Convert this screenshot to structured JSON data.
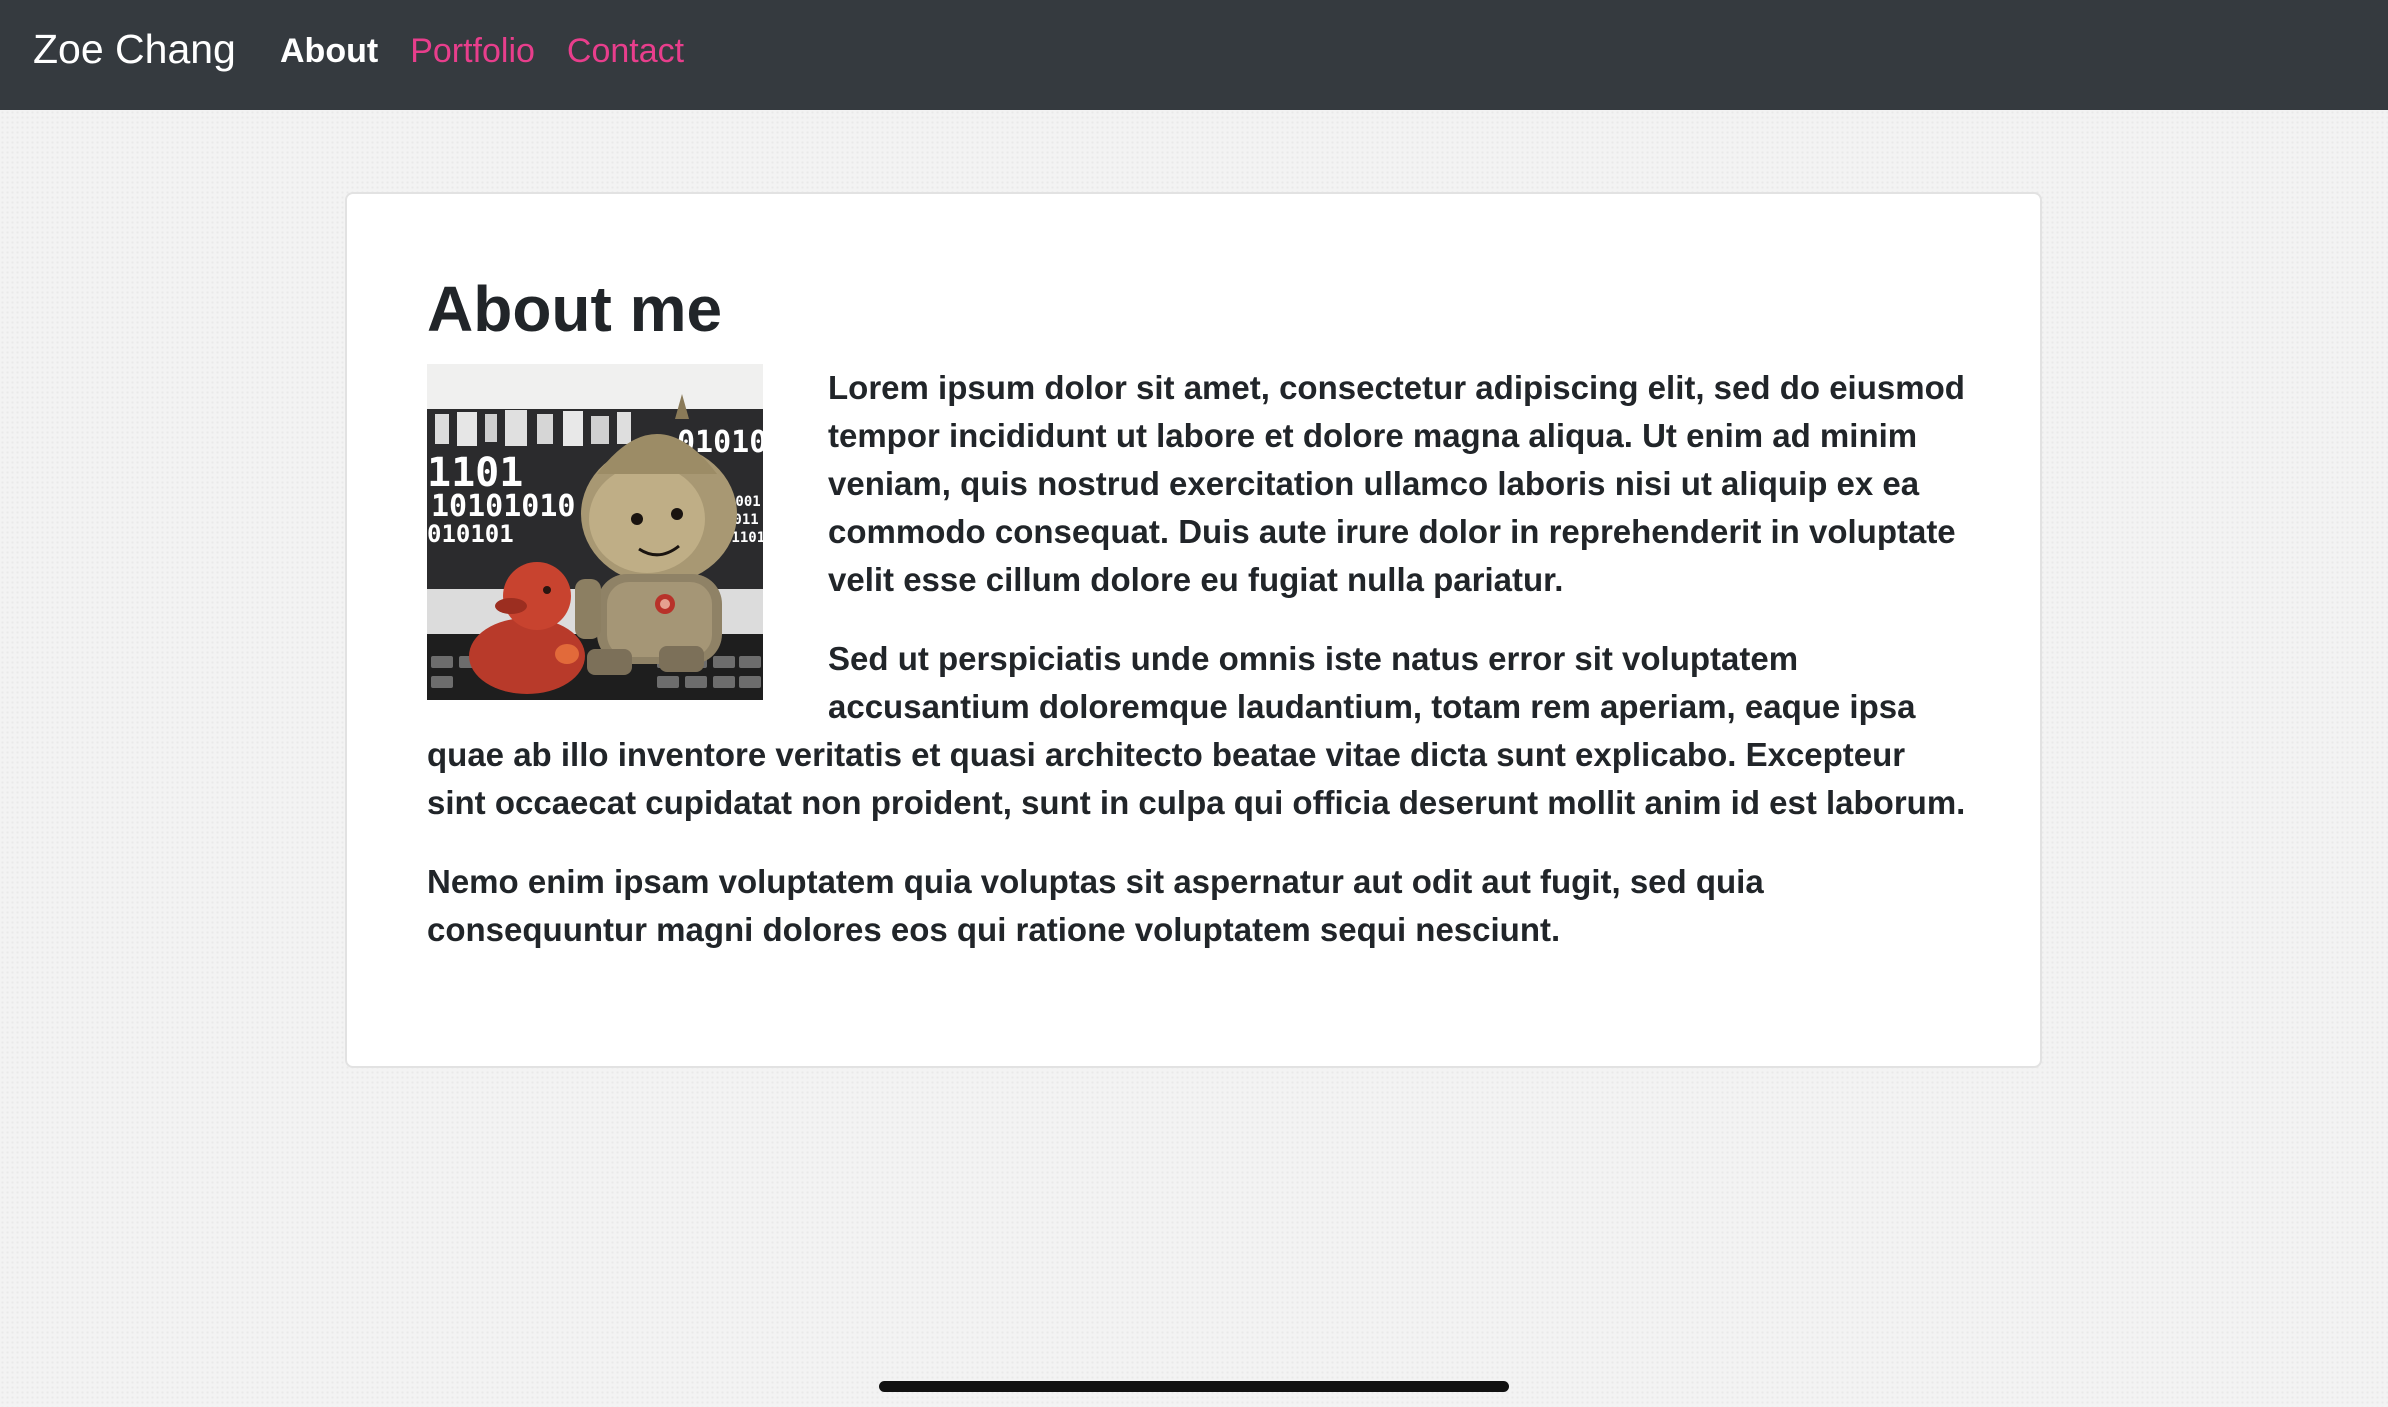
{
  "navbar": {
    "brand": "Zoe Chang",
    "links": [
      {
        "label": "About",
        "active": true
      },
      {
        "label": "Portfolio",
        "active": false
      },
      {
        "label": "Contact",
        "active": false
      }
    ],
    "background": "#353a3f",
    "accent": "#e83e8c"
  },
  "main": {
    "title": "About me",
    "paragraphs": [
      "Lorem ipsum dolor sit amet, consectetur adipiscing elit, sed do eiusmod tempor incididunt ut labore et dolore magna aliqua. Ut enim ad minim veniam, quis nostrud exercitation ullamco laboris nisi ut aliquip ex ea commodo consequat. Duis aute irure dolor in reprehenderit in voluptate velit esse cillum dolore eu fugiat nulla pariatur.",
      "Sed ut perspiciatis unde omnis iste natus error sit voluptatem accusantium doloremque laudantium, totam rem aperiam, eaque ipsa quae ab illo inventore veritatis et quasi architecto beatae vitae dicta sunt explicabo. Excepteur sint occaecat cupidatat non proident, sunt in culpa qui officia deserunt mollit anim id est laborum.",
      "Nemo enim ipsam voluptatem quia voluptas sit aspernatur aut odit aut fugit, sed quia consequuntur magni dolores eos qui ratione voluptatem sequi nesciunt."
    ],
    "photo_binary_text": [
      "01010",
      "1101",
      "10101010",
      "010101",
      "1001",
      "0011",
      "01101"
    ]
  }
}
